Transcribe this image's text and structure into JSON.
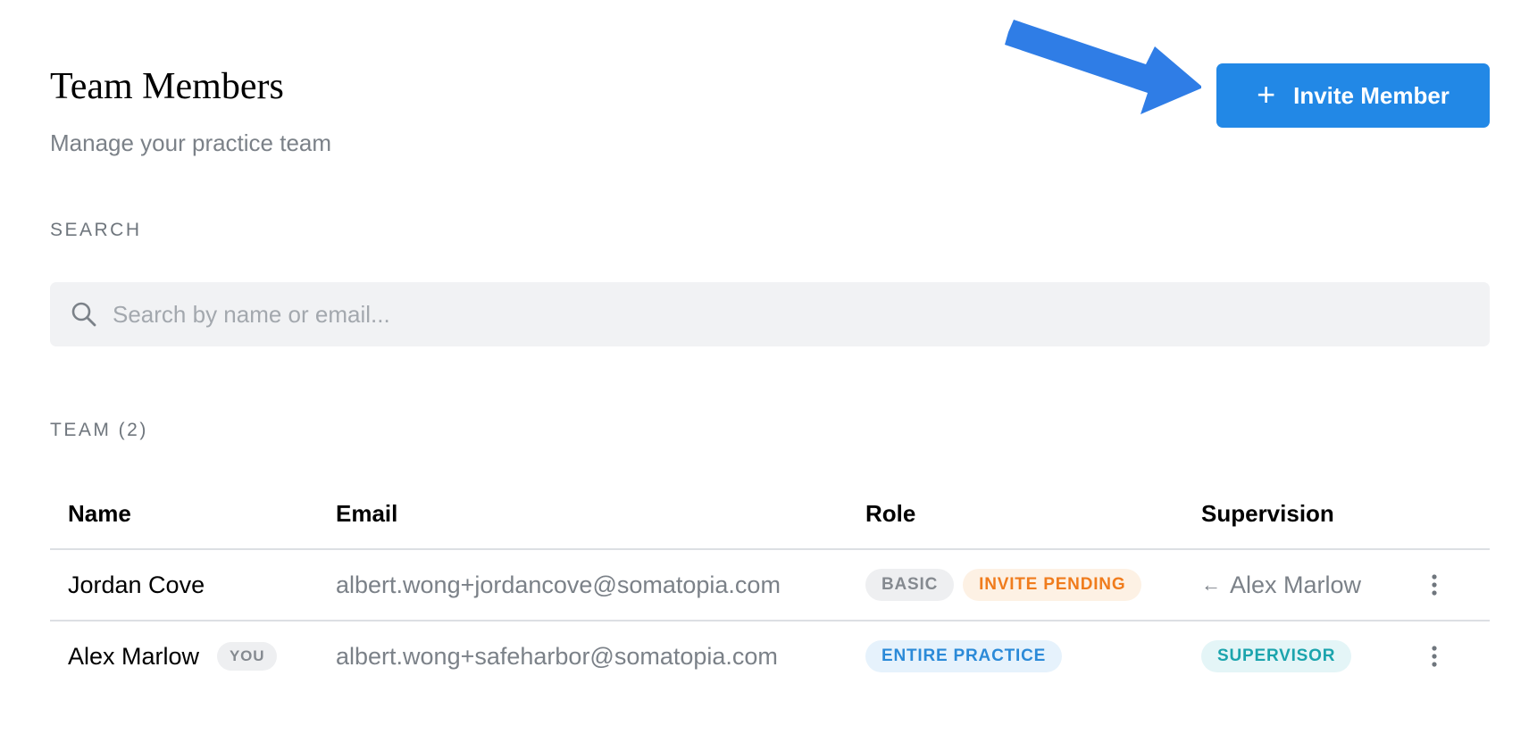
{
  "header": {
    "title": "Team Members",
    "subtitle": "Manage your practice team",
    "invite_button": {
      "icon": "plus-icon",
      "label": "Invite Member"
    }
  },
  "search": {
    "section_label": "SEARCH",
    "placeholder": "Search by name or email...",
    "value": "",
    "icon": "search-icon"
  },
  "team": {
    "section_label": "TEAM (2)",
    "columns": [
      "Name",
      "Email",
      "Role",
      "Supervision"
    ],
    "rows": [
      {
        "name": "Jordan Cove",
        "email": "albert.wong+jordancove@somatopia.com",
        "role_badges": [
          "BASIC",
          "INVITE PENDING"
        ],
        "supervision_arrow": "←",
        "supervision": "Alex Marlow"
      },
      {
        "name": "Alex Marlow",
        "you_badge": "YOU",
        "email": "albert.wong+safeharbor@somatopia.com",
        "role_badges": [
          "ENTIRE PRACTICE"
        ],
        "supervision_badge": "SUPERVISOR"
      }
    ]
  },
  "colors": {
    "primary": "#2288e6",
    "annotation_arrow": "#2f7de6",
    "badge_orange": "#f07c1d",
    "badge_blue": "#2b8ad8",
    "badge_teal": "#1ba4ad",
    "muted_text": "#7b8188"
  }
}
